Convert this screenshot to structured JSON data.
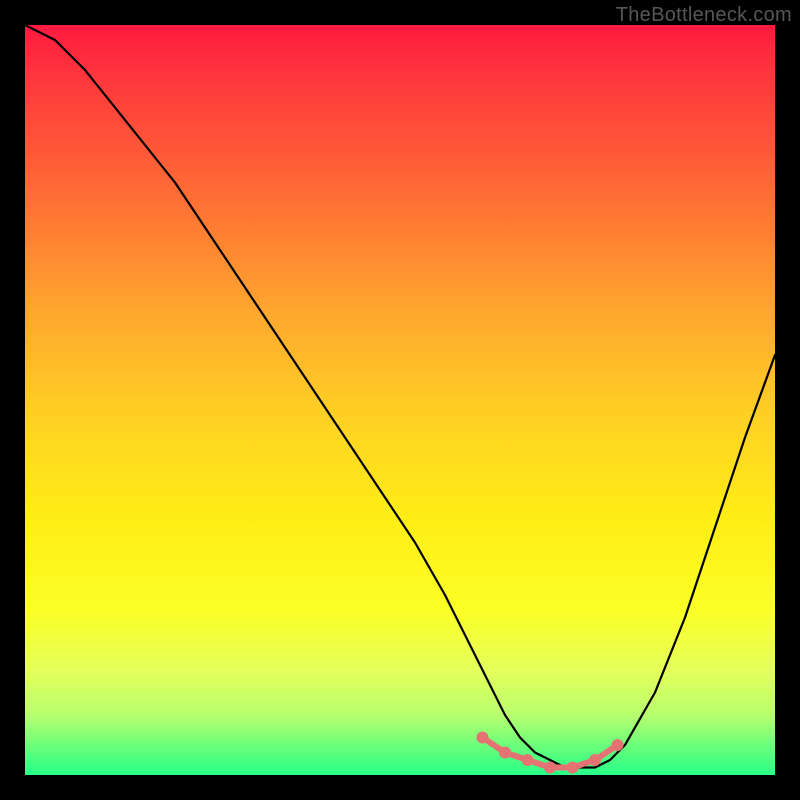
{
  "watermark": "TheBottleneck.com",
  "chart_data": {
    "type": "line",
    "title": "",
    "xlabel": "",
    "ylabel": "",
    "xlim": [
      0,
      100
    ],
    "ylim": [
      0,
      100
    ],
    "series": [
      {
        "name": "bottleneck-curve",
        "x": [
          0,
          4,
          8,
          12,
          16,
          20,
          24,
          28,
          32,
          36,
          40,
          44,
          48,
          52,
          56,
          58,
          60,
          62,
          64,
          66,
          68,
          70,
          72,
          74,
          76,
          78,
          80,
          84,
          88,
          92,
          96,
          100
        ],
        "values": [
          100,
          98,
          94,
          89,
          84,
          79,
          73,
          67,
          61,
          55,
          49,
          43,
          37,
          31,
          24,
          20,
          16,
          12,
          8,
          5,
          3,
          2,
          1,
          1,
          1,
          2,
          4,
          11,
          21,
          33,
          45,
          56
        ]
      }
    ],
    "markers": {
      "name": "optimal-zone-dots",
      "color": "#e57373",
      "x": [
        61,
        64,
        67,
        70,
        73,
        76,
        79
      ],
      "values": [
        5,
        3,
        2,
        1,
        1,
        2,
        4
      ]
    }
  }
}
